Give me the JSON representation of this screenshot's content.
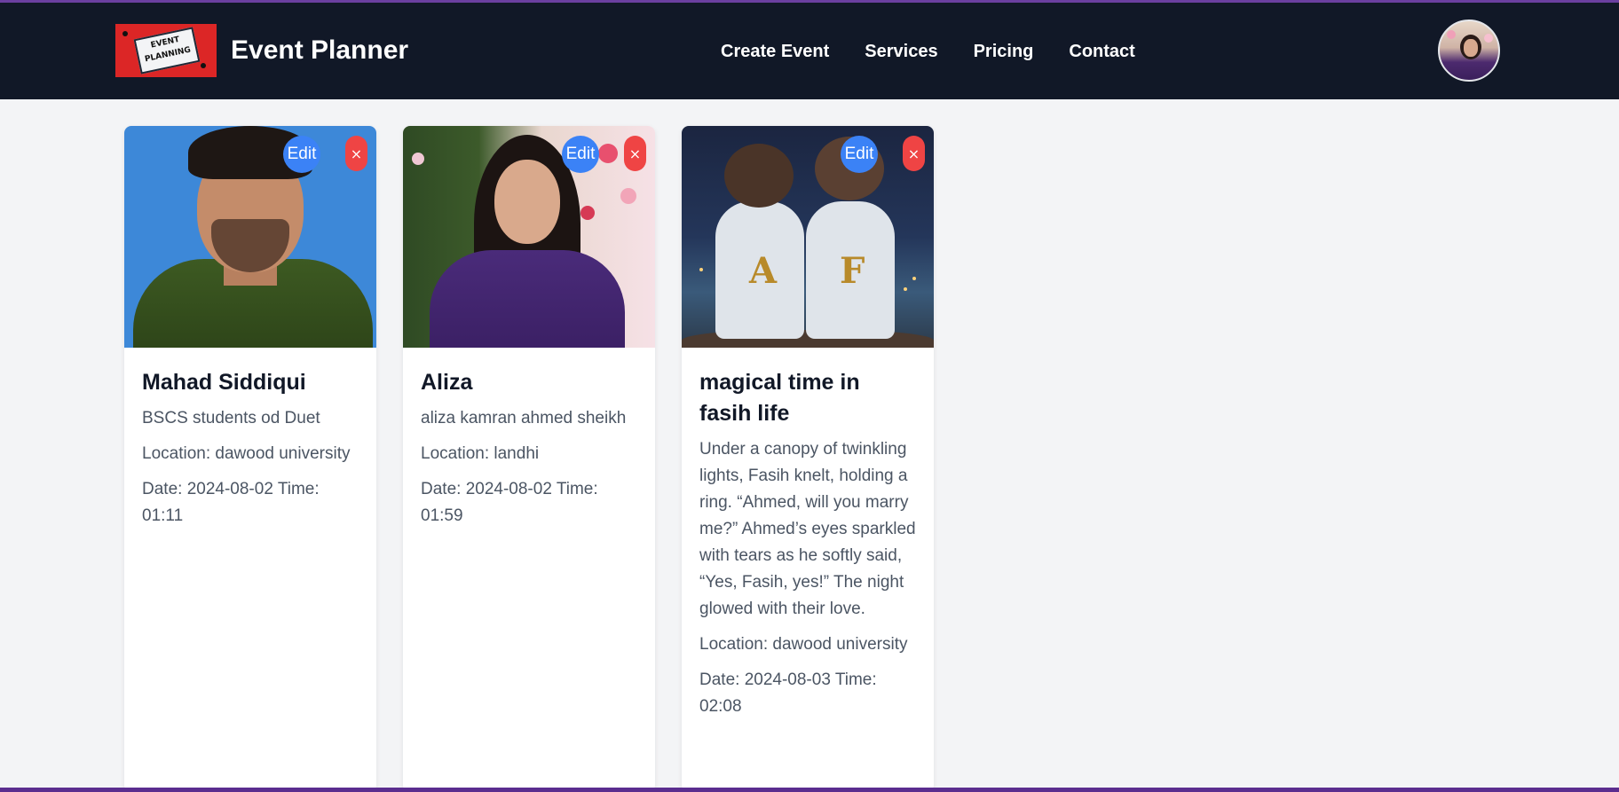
{
  "header": {
    "logo_line1": "EVENT",
    "logo_line2": "PLANNING",
    "brand": "Event Planner",
    "nav": [
      {
        "label": "Create Event"
      },
      {
        "label": "Services"
      },
      {
        "label": "Pricing"
      },
      {
        "label": "Contact"
      }
    ]
  },
  "colors": {
    "header_bg": "#111827",
    "page_bg": "#f3f4f6",
    "edit_button": "#3b82f6",
    "delete_button": "#ef4444",
    "accent_strip": "#6b3fa0"
  },
  "cards": [
    {
      "edit_label": "Edit",
      "delete_label": "×",
      "title": "Mahad Siddiqui",
      "description": "BSCS students od Duet",
      "location": "Location: dawood university",
      "datetime": "Date: 2024-08-02 Time: 01:11"
    },
    {
      "edit_label": "Edit",
      "delete_label": "×",
      "title": "Aliza",
      "description": "aliza kamran ahmed sheikh",
      "location": "Location: landhi",
      "datetime": "Date: 2024-08-02 Time: 01:59"
    },
    {
      "edit_label": "Edit",
      "delete_label": "×",
      "title": "magical time in fasih life",
      "description": "Under a canopy of twinkling lights, Fasih knelt, holding a ring. “Ahmed, will you marry me?” Ahmed’s eyes sparkled with tears as he softly said, “Yes, Fasih, yes!” The night glowed with their love.",
      "location": "Location: dawood university",
      "datetime": "Date: 2024-08-03 Time: 02:08",
      "image_letters": [
        "A",
        "F"
      ]
    }
  ]
}
